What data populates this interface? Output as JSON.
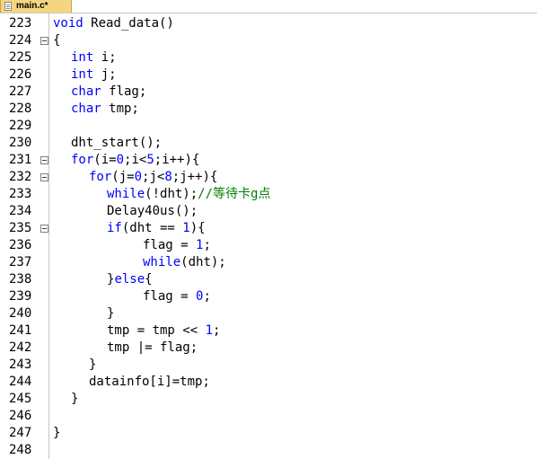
{
  "tab": {
    "label": "main.c*"
  },
  "lines": [
    {
      "n": "223",
      "fold": false,
      "indent": 0,
      "tokens": [
        [
          "kw",
          "void"
        ],
        [
          "p",
          " Read_data()"
        ]
      ]
    },
    {
      "n": "224",
      "fold": true,
      "indent": 0,
      "tokens": [
        [
          "p",
          "{"
        ]
      ]
    },
    {
      "n": "225",
      "fold": false,
      "indent": 1,
      "tokens": [
        [
          "kw",
          "int"
        ],
        [
          "p",
          " i;"
        ]
      ]
    },
    {
      "n": "226",
      "fold": false,
      "indent": 1,
      "tokens": [
        [
          "kw",
          "int"
        ],
        [
          "p",
          " j;"
        ]
      ]
    },
    {
      "n": "227",
      "fold": false,
      "indent": 1,
      "tokens": [
        [
          "kw",
          "char"
        ],
        [
          "p",
          " flag;"
        ]
      ]
    },
    {
      "n": "228",
      "fold": false,
      "indent": 1,
      "tokens": [
        [
          "kw",
          "char"
        ],
        [
          "p",
          " tmp;"
        ]
      ]
    },
    {
      "n": "229",
      "fold": false,
      "indent": 0,
      "tokens": []
    },
    {
      "n": "230",
      "fold": false,
      "indent": 1,
      "tokens": [
        [
          "p",
          "dht_start();"
        ]
      ]
    },
    {
      "n": "231",
      "fold": true,
      "indent": 1,
      "tokens": [
        [
          "kw",
          "for"
        ],
        [
          "p",
          "(i="
        ],
        [
          "num",
          "0"
        ],
        [
          "p",
          ";i<"
        ],
        [
          "num",
          "5"
        ],
        [
          "p",
          ";i++){"
        ]
      ]
    },
    {
      "n": "232",
      "fold": true,
      "indent": 2,
      "tokens": [
        [
          "kw",
          "for"
        ],
        [
          "p",
          "(j="
        ],
        [
          "num",
          "0"
        ],
        [
          "p",
          ";j<"
        ],
        [
          "num",
          "8"
        ],
        [
          "p",
          ";j++){"
        ]
      ]
    },
    {
      "n": "233",
      "fold": false,
      "indent": 3,
      "tokens": [
        [
          "kw",
          "while"
        ],
        [
          "p",
          "(!dht);"
        ],
        [
          "cm",
          "//等待卡g点"
        ]
      ]
    },
    {
      "n": "234",
      "fold": false,
      "indent": 3,
      "tokens": [
        [
          "p",
          "Delay40us();"
        ]
      ]
    },
    {
      "n": "235",
      "fold": true,
      "indent": 3,
      "tokens": [
        [
          "kw",
          "if"
        ],
        [
          "p",
          "(dht == "
        ],
        [
          "num",
          "1"
        ],
        [
          "p",
          "){"
        ]
      ]
    },
    {
      "n": "236",
      "fold": false,
      "indent": 5,
      "tokens": [
        [
          "p",
          "flag = "
        ],
        [
          "num",
          "1"
        ],
        [
          "p",
          ";"
        ]
      ]
    },
    {
      "n": "237",
      "fold": false,
      "indent": 5,
      "tokens": [
        [
          "kw",
          "while"
        ],
        [
          "p",
          "(dht);"
        ]
      ]
    },
    {
      "n": "238",
      "fold": false,
      "indent": 3,
      "tokens": [
        [
          "p",
          "}"
        ],
        [
          "kw",
          "else"
        ],
        [
          "p",
          "{"
        ]
      ]
    },
    {
      "n": "239",
      "fold": false,
      "indent": 5,
      "tokens": [
        [
          "p",
          "flag = "
        ],
        [
          "num",
          "0"
        ],
        [
          "p",
          ";"
        ]
      ]
    },
    {
      "n": "240",
      "fold": false,
      "indent": 3,
      "tokens": [
        [
          "p",
          "}"
        ]
      ]
    },
    {
      "n": "241",
      "fold": false,
      "indent": 3,
      "tokens": [
        [
          "p",
          "tmp = tmp << "
        ],
        [
          "num",
          "1"
        ],
        [
          "p",
          ";"
        ]
      ]
    },
    {
      "n": "242",
      "fold": false,
      "indent": 3,
      "tokens": [
        [
          "p",
          "tmp |= flag;"
        ]
      ]
    },
    {
      "n": "243",
      "fold": false,
      "indent": 2,
      "tokens": [
        [
          "p",
          "}"
        ]
      ]
    },
    {
      "n": "244",
      "fold": false,
      "indent": 2,
      "tokens": [
        [
          "p",
          "datainfo[i]=tmp;"
        ]
      ]
    },
    {
      "n": "245",
      "fold": false,
      "indent": 1,
      "tokens": [
        [
          "p",
          "}"
        ]
      ]
    },
    {
      "n": "246",
      "fold": false,
      "indent": 0,
      "tokens": []
    },
    {
      "n": "247",
      "fold": false,
      "indent": 0,
      "tokens": [
        [
          "p",
          "}"
        ]
      ]
    },
    {
      "n": "248",
      "fold": false,
      "indent": 0,
      "tokens": []
    }
  ],
  "colors": {
    "keyword": "#0000ff",
    "number": "#0000ff",
    "comment": "#008000",
    "text": "#000000"
  }
}
